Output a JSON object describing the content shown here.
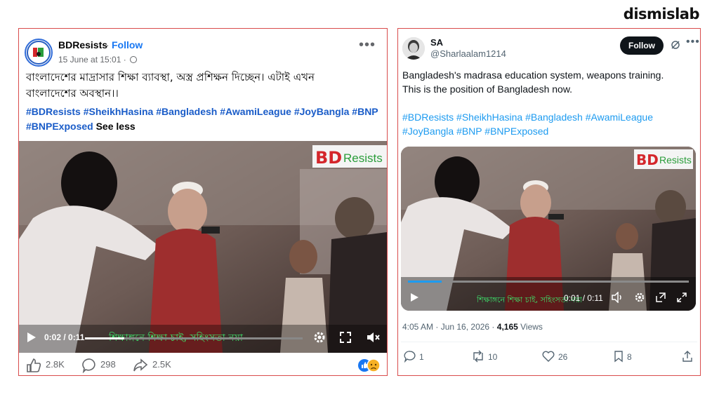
{
  "brand": "dismislab",
  "facebook_post": {
    "page_name": "BDResists",
    "separator": "·",
    "follow_label": "Follow",
    "timestamp": "15 June at 15:01 ·",
    "more_label": "•••",
    "text_line1": "বাংলাদেশের মাদ্রাসার শিক্ষা ব্যাবস্থা, অস্ত্র প্রশিক্ষন দিচ্ছেন। এটাই এখন",
    "text_line2": "বাংলাদেশের অবস্থান।।",
    "hashtags": [
      "#BDResists",
      "#SheikhHasina",
      "#Bangladesh",
      "#AwamiLeague",
      "#JoyBangla",
      "#BNP",
      "#BNPExposed"
    ],
    "see_less": "See less",
    "video": {
      "time": "0:02 / 0:11",
      "subtitle": "শিক্ষাঙ্গনে শিক্ষা চাই, সহিংসতা নয়া",
      "watermark_bd": "BD",
      "watermark_resists": "Resists",
      "progress": 0.18
    },
    "likes": "2.8K",
    "comments": "298",
    "shares": "2.5K"
  },
  "x_post": {
    "display_name": "SA",
    "handle": "@Sharlaalam1214",
    "follow_label": "Follow",
    "more_label": "•••",
    "text_line1": "Bangladesh's madrasa education system, weapons training.",
    "text_line2": "This is the position of Bangladesh now.",
    "hashtags_line1": [
      "#BDResists",
      "#SheikhHasina",
      "#Bangladesh",
      "#AwamiLeague"
    ],
    "hashtags_line2": [
      "#JoyBangla",
      "#BNP",
      "#BNPExposed"
    ],
    "video": {
      "time": "0:01 / 0:11",
      "subtitle": "শিক্ষাঙ্গনে শিক্ষা চাই, সহিংসতা নয়া",
      "watermark_bd": "BD",
      "watermark_resists": "Resists",
      "progress": 0.12
    },
    "meta_time": "4:05 AM · Jun 16, 2026 ·",
    "views_count": "4,165",
    "views_label": "Views",
    "replies": "1",
    "reposts": "10",
    "likes": "26",
    "bookmarks": "8"
  },
  "colors": {
    "fb_blue": "#1877f2",
    "fb_hashtag": "#1a5cc8",
    "x_blue": "#1d9bf0",
    "card_border": "#d94c4c",
    "watermark_red": "#d4262b"
  }
}
